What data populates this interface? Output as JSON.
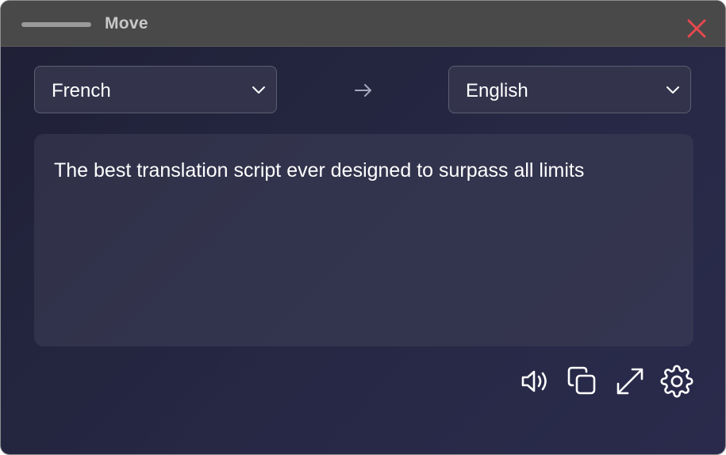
{
  "window": {
    "title": "Move"
  },
  "source_language": {
    "selected": "French"
  },
  "target_language": {
    "selected": "English"
  },
  "translation": {
    "text": "The best translation script ever designed to surpass all limits"
  },
  "icons": {
    "close": "close-icon",
    "chevron": "chevron-down-icon",
    "arrow": "arrow-right-icon",
    "speak": "speaker-icon",
    "copy": "copy-icon",
    "expand": "expand-icon",
    "settings": "gear-icon"
  },
  "colors": {
    "close": "#e5484d",
    "background": "#24253f",
    "titlebar": "#494949"
  }
}
